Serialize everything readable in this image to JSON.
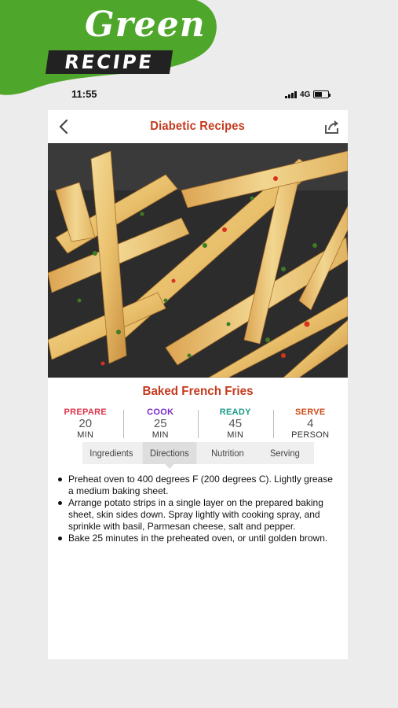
{
  "brand": {
    "line1": "Green",
    "line2": "RECIPE"
  },
  "status_bar": {
    "time": "11:55",
    "network": "4G"
  },
  "nav": {
    "title": "Diabetic Recipes",
    "back_icon": "chevron-left-icon",
    "share_icon": "share-icon"
  },
  "recipe": {
    "name": "Baked French Fries"
  },
  "stats": [
    {
      "label": "PREPARE",
      "value": "20",
      "unit": "MIN",
      "color": "#d9344a"
    },
    {
      "label": "COOK",
      "value": "25",
      "unit": "MIN",
      "color": "#7b2cc9"
    },
    {
      "label": "READY",
      "value": "45",
      "unit": "MIN",
      "color": "#1d9a8a"
    },
    {
      "label": "SERVE",
      "value": "4",
      "unit": "PERSON",
      "color": "#cc4a16"
    }
  ],
  "tabs": [
    {
      "label": "Ingredients"
    },
    {
      "label": "Directions"
    },
    {
      "label": "Nutrition"
    },
    {
      "label": "Serving"
    }
  ],
  "active_tab": "Directions",
  "directions": [
    "Preheat oven to 400 degrees F (200 degrees C). Lightly grease a medium baking sheet.",
    "Arrange potato strips in a single layer on the prepared baking sheet, skin sides down. Spray lightly with cooking spray, and sprinkle with basil, Parmesan cheese, salt and pepper.",
    "Bake 25 minutes in the preheated oven, or until golden brown."
  ],
  "colors": {
    "brand_green": "#4ea62a",
    "accent_red": "#c53a1e",
    "background": "#ececec"
  }
}
